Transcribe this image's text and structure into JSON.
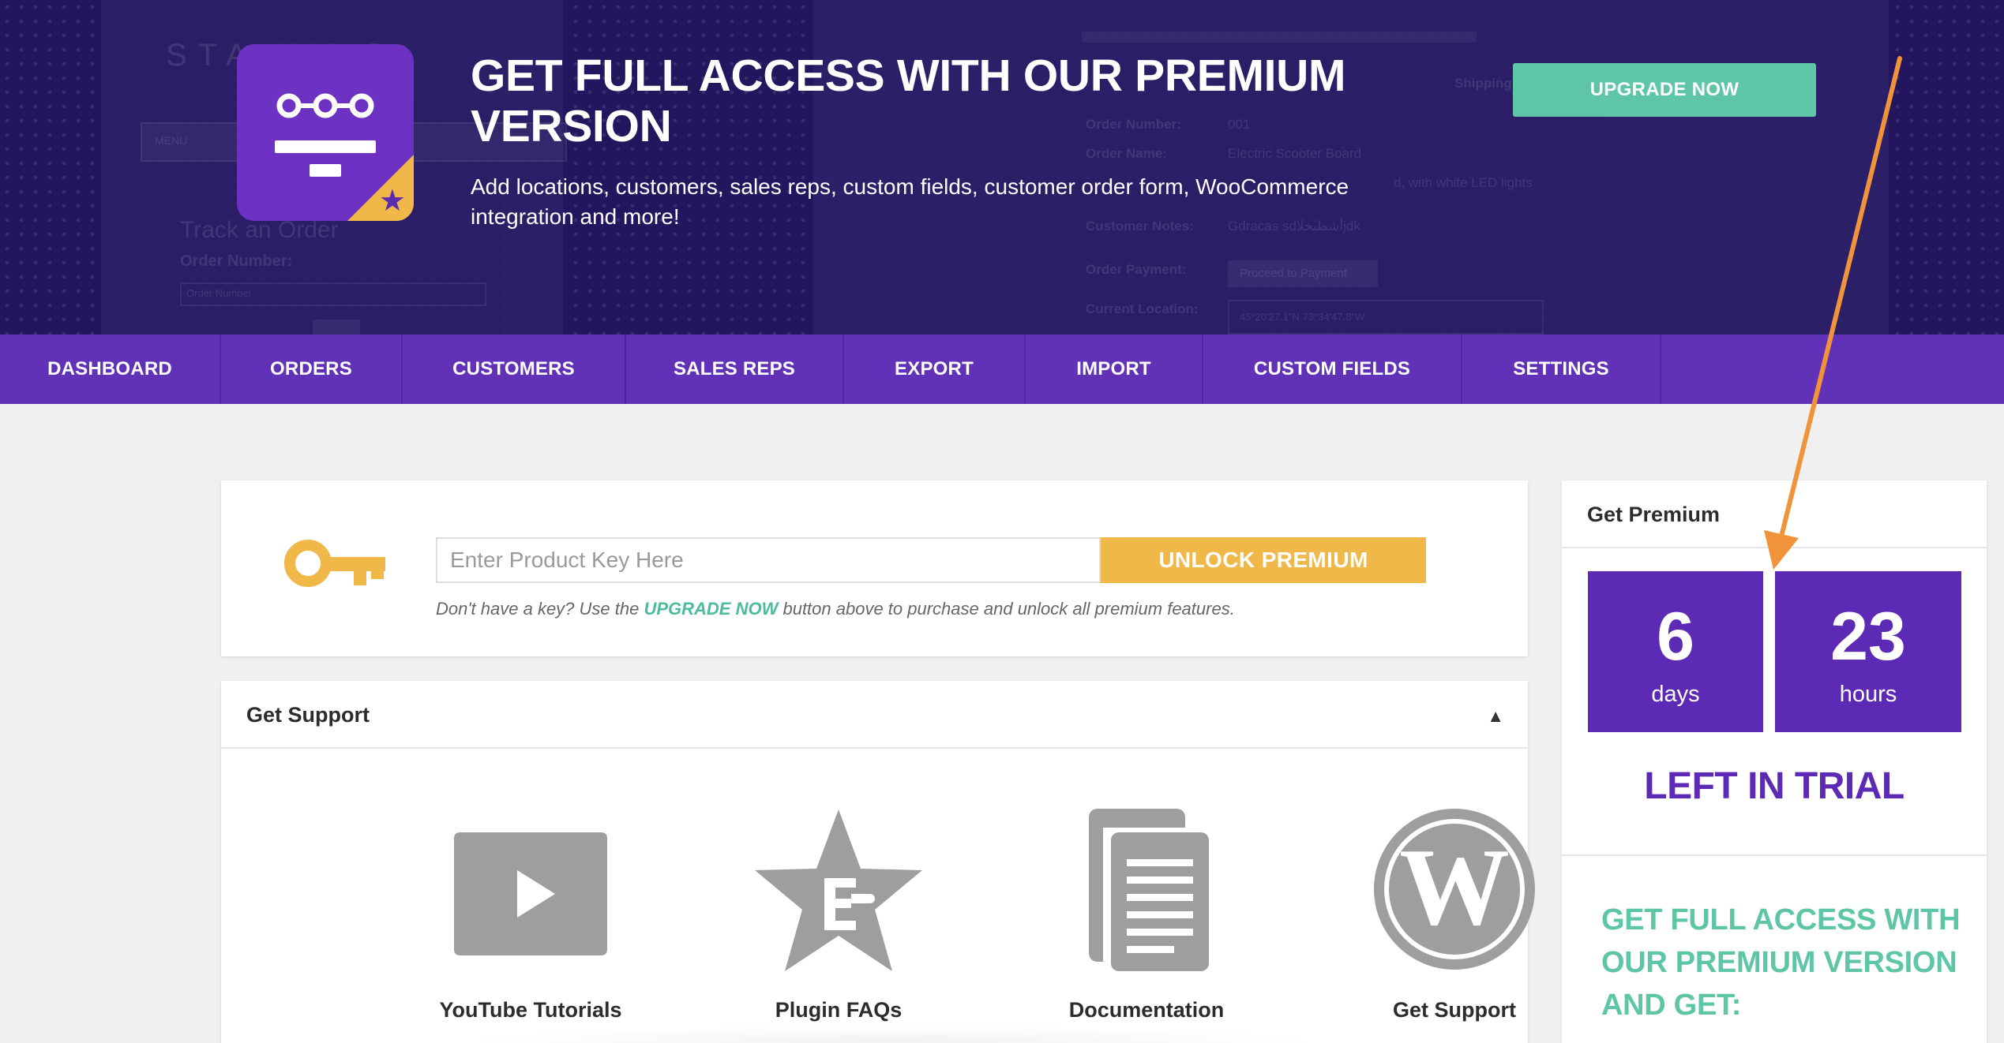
{
  "banner": {
    "title": "GET FULL ACCESS WITH OUR PREMIUM VERSION",
    "subtitle": "Add locations, customers, sales reps, custom fields, customer order form, WooCommerce integration and more!",
    "upgrade_label": "UPGRADE NOW",
    "background_texts": {
      "brand": "STA    KING",
      "menu": "MENU",
      "track_heading": "Track an Order",
      "order_number_label": "Order Number:",
      "order_number_placeholder": "Order Number",
      "shipping": "Shipping",
      "field_order_number": "Order Number:",
      "field_order_number_value": "001",
      "field_order_name": "Order Name:",
      "field_order_name_value": "Electric Scooter Board",
      "field_order_desc_value": "d, with white LED lights",
      "field_customer_notes": "Customer Notes:",
      "field_customer_notes_value": "Gdracas sdأشطبخلاjdk",
      "field_order_payment": "Order Payment:",
      "field_payment_button": "Proceed to Payment",
      "field_current_location": "Current Location:",
      "field_location_value": "45°20'27.1\"N 73°34'47.8\"W"
    }
  },
  "nav": {
    "items": [
      {
        "label": "DASHBOARD"
      },
      {
        "label": "ORDERS"
      },
      {
        "label": "CUSTOMERS"
      },
      {
        "label": "SALES REPS"
      },
      {
        "label": "EXPORT"
      },
      {
        "label": "IMPORT"
      },
      {
        "label": "CUSTOM FIELDS"
      },
      {
        "label": "SETTINGS"
      }
    ]
  },
  "license": {
    "key_placeholder": "Enter Product Key Here",
    "unlock_label": "UNLOCK PREMIUM",
    "note_before": "Don't have a key? Use the ",
    "note_highlight": "UPGRADE NOW",
    "note_after": " button above to purchase and unlock all premium features."
  },
  "support": {
    "title": "Get Support",
    "items": [
      {
        "label": "YouTube Tutorials",
        "icon": "youtube-icon"
      },
      {
        "label": "Plugin FAQs",
        "icon": "faq-star-icon"
      },
      {
        "label": "Documentation",
        "icon": "documentation-icon"
      },
      {
        "label": "Get Support",
        "icon": "wordpress-icon"
      }
    ]
  },
  "premium": {
    "title": "Get Premium",
    "days_value": "6",
    "days_unit": "days",
    "hours_value": "23",
    "hours_unit": "hours",
    "left_in_trial": "LEFT IN TRIAL",
    "cta": "GET FULL ACCESS WITH OUR PREMIUM VERSION AND GET:"
  },
  "colors": {
    "banner_bg": "#23155e",
    "nav_bg": "#6131b8",
    "accent_purple": "#5d2ab6",
    "accent_green": "#5ec6a6",
    "accent_yellow": "#f0b849",
    "annotation_arrow": "#f0933a"
  }
}
